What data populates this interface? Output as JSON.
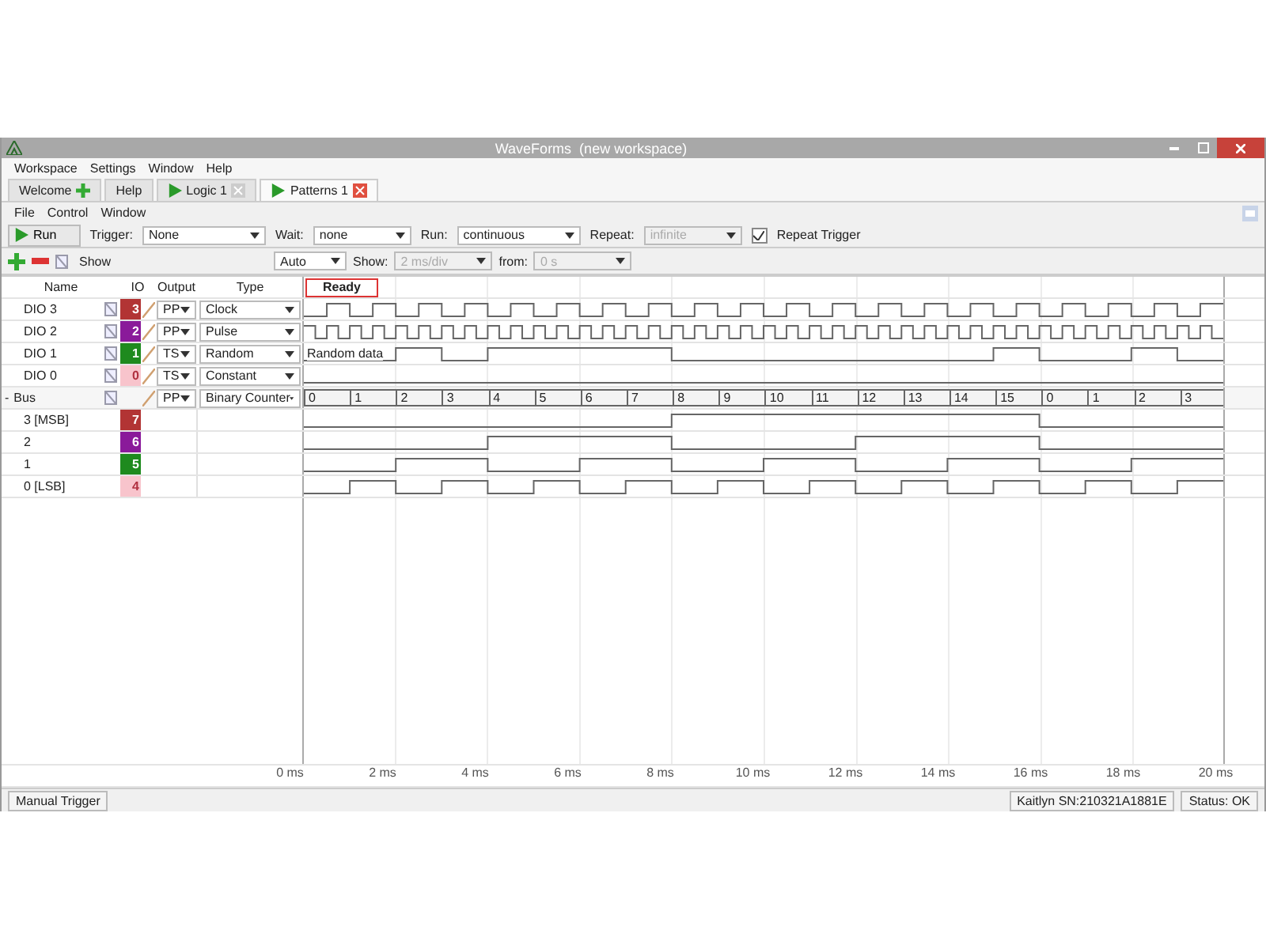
{
  "window": {
    "title": "WaveForms  (new workspace)"
  },
  "menu": [
    "Workspace",
    "Settings",
    "Window",
    "Help"
  ],
  "tabs": [
    {
      "label": "Welcome",
      "kind": "start",
      "selected": false
    },
    {
      "label": "Help",
      "kind": "plain",
      "selected": false
    },
    {
      "label": "Logic 1",
      "kind": "instrument",
      "selected": false
    },
    {
      "label": "Patterns 1",
      "kind": "instrument",
      "selected": true
    }
  ],
  "submenu": [
    "File",
    "Control",
    "Window"
  ],
  "toolbar": {
    "run": "Run",
    "fields": [
      {
        "label": "Trigger:",
        "value": "None",
        "disabled": false
      },
      {
        "label": "Wait:",
        "value": "none",
        "disabled": false
      },
      {
        "label": "Run:",
        "value": "continuous",
        "disabled": false
      },
      {
        "label": "Repeat:",
        "value": "infinite",
        "disabled": true
      }
    ],
    "repeat_trigger": {
      "label": "Repeat Trigger",
      "checked": true
    }
  },
  "view_bar": {
    "show": "Show",
    "fields": [
      {
        "value": "Auto",
        "disabled": false
      },
      {
        "label": "Show:",
        "value": "2 ms/div",
        "disabled": true
      },
      {
        "label": "from:",
        "value": "0 s",
        "disabled": true
      }
    ]
  },
  "columns": [
    "Name",
    "IO",
    "Output",
    "Type"
  ],
  "status_label": "Ready",
  "signals": [
    {
      "name": "DIO 3",
      "pin": "3",
      "color": "#b23434",
      "output": "PP",
      "type": "Clock",
      "kind": "clock"
    },
    {
      "name": "DIO 2",
      "pin": "2",
      "color": "#8a1a9a",
      "output": "PP",
      "type": "Pulse",
      "kind": "pulse"
    },
    {
      "name": "DIO 1",
      "pin": "1",
      "color": "#1e8a1e",
      "output": "TS",
      "type": "Random",
      "kind": "random",
      "wave_label": "Random data"
    },
    {
      "name": "DIO 0",
      "pin": "0",
      "color": "#f8c4cc",
      "output": "TS",
      "type": "Constant",
      "kind": "constant"
    }
  ],
  "bus": {
    "toggle": "-",
    "name": "Bus",
    "output": "PP",
    "type": "Binary Counter",
    "values": [
      "0",
      "1",
      "2",
      "3",
      "4",
      "5",
      "6",
      "7",
      "8",
      "9",
      "10",
      "11",
      "12",
      "13",
      "14",
      "15",
      "0",
      "1",
      "2",
      "3"
    ],
    "children": [
      {
        "name": "3 [MSB]",
        "pin": "7",
        "color": "#b23434"
      },
      {
        "name": "2",
        "pin": "6",
        "color": "#8a1a9a"
      },
      {
        "name": "1",
        "pin": "5",
        "color": "#1e8a1e"
      },
      {
        "name": "0 [LSB]",
        "pin": "4",
        "color": "#f8c4cc"
      }
    ]
  },
  "axis": [
    "0 ms",
    "2 ms",
    "4 ms",
    "6 ms",
    "8 ms",
    "10 ms",
    "12 ms",
    "14 ms",
    "16 ms",
    "18 ms",
    "20 ms"
  ],
  "status_bar": {
    "trigger": "Manual Trigger",
    "device": "Kaitlyn SN:210321A1881E",
    "status": "Status: OK"
  }
}
